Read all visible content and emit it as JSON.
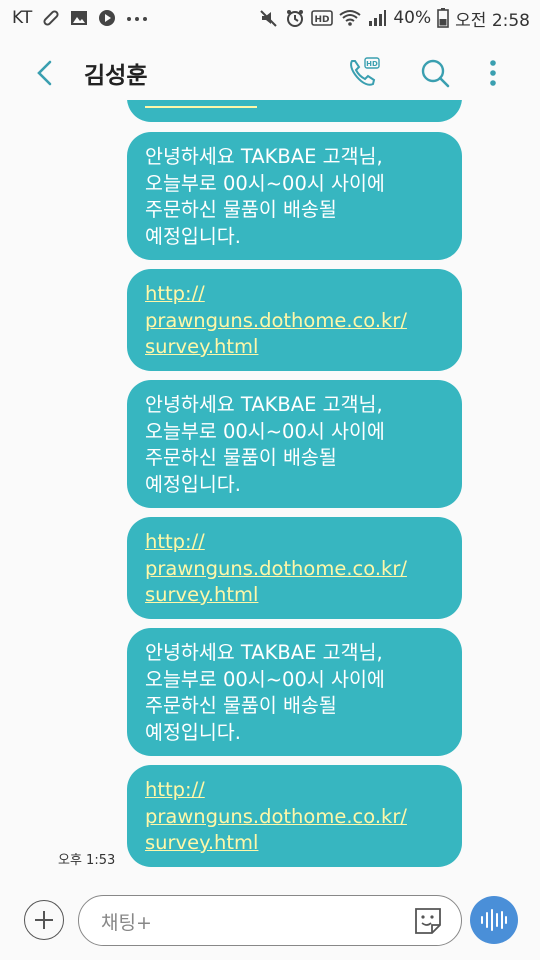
{
  "status_bar": {
    "carrier": "KT",
    "battery": "40%",
    "time": "오전 2:58",
    "icons": [
      "link-icon",
      "image-icon",
      "play-icon",
      "more-dots-icon",
      "mute-icon",
      "alarm-icon",
      "hd-icon",
      "wifi-icon",
      "signal-icon",
      "battery-icon"
    ]
  },
  "header": {
    "contact_name": "김성훈",
    "icons": [
      "back-arrow-icon",
      "hd-call-icon",
      "search-icon",
      "more-vertical-icon"
    ]
  },
  "messages": [
    {
      "type": "text",
      "lines": [
        "안녕하세요 TAKBAE 고객님,",
        "오늘부로 00시~00시 사이에",
        "주문하신 물품이 배송될",
        "예정입니다."
      ]
    },
    {
      "type": "link",
      "lines": [
        "http://",
        "prawnguns.dothome.co.kr/",
        "survey.html"
      ]
    },
    {
      "type": "text",
      "lines": [
        "안녕하세요 TAKBAE 고객님,",
        "오늘부로 00시~00시 사이에",
        "주문하신 물품이 배송될",
        "예정입니다."
      ]
    },
    {
      "type": "link",
      "lines": [
        "http://",
        "prawnguns.dothome.co.kr/",
        "survey.html"
      ]
    },
    {
      "type": "text",
      "lines": [
        "안녕하세요 TAKBAE 고객님,",
        "오늘부로 00시~00시 사이에",
        "주문하신 물품이 배송될",
        "예정입니다."
      ]
    },
    {
      "type": "link",
      "lines": [
        "http://",
        "prawnguns.dothome.co.kr/",
        "survey.html"
      ]
    }
  ],
  "last_message_time": "오후 1:53",
  "composer": {
    "placeholder": "채팅+",
    "icons": [
      "add-icon",
      "sticker-icon",
      "voice-input-icon"
    ]
  },
  "colors": {
    "bubble": "#37b6c0",
    "link_text": "#fff7a8",
    "accent": "#3a9fb0"
  }
}
